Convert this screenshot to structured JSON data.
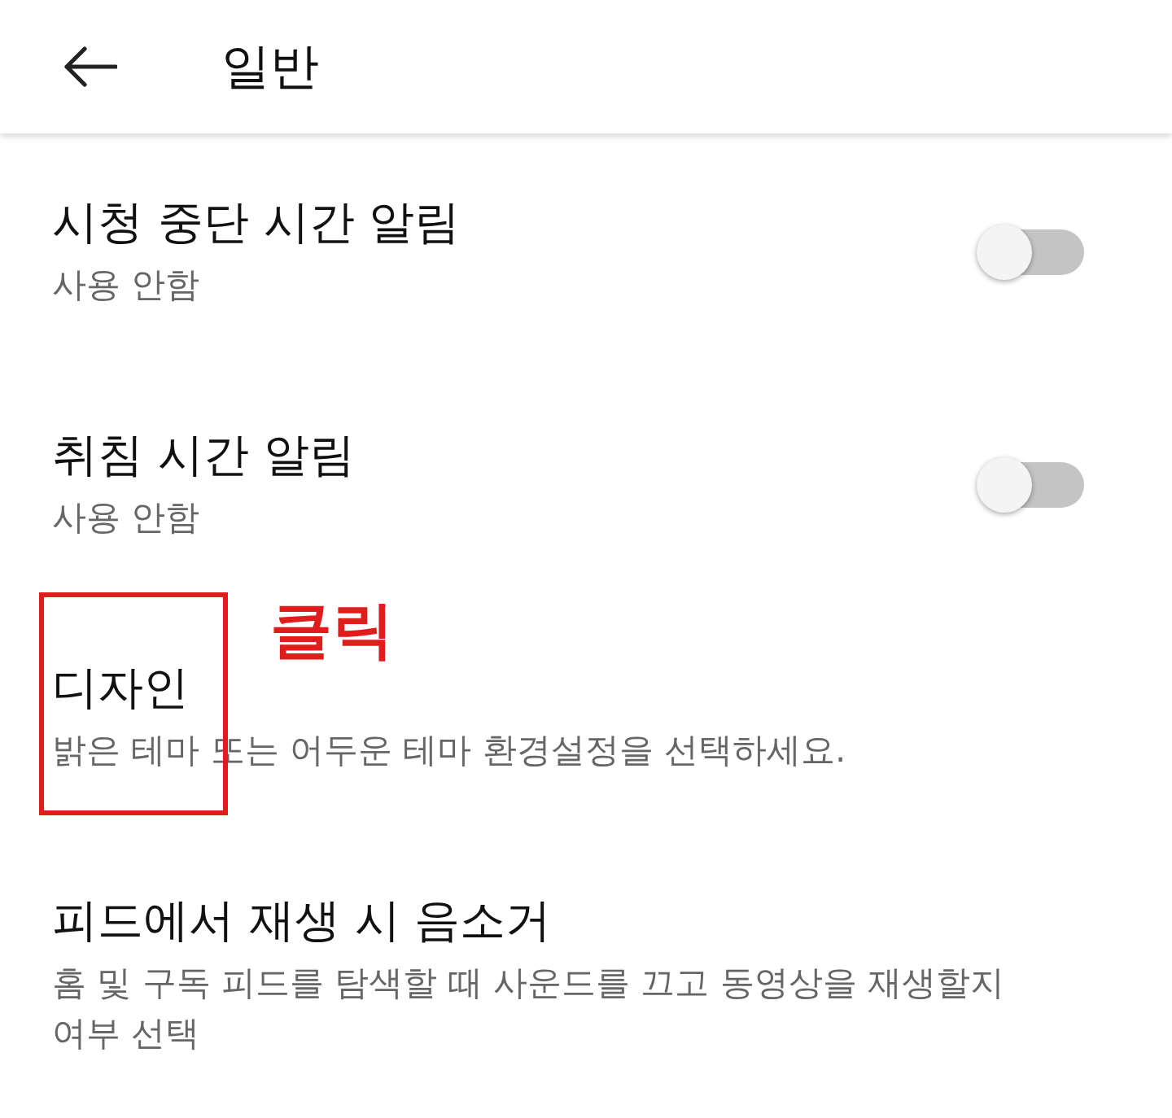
{
  "header": {
    "title": "일반"
  },
  "settings": [
    {
      "kind": "toggle",
      "title": "시청 중단 시간 알림",
      "subtitle": "사용 안함",
      "on": false
    },
    {
      "kind": "toggle",
      "title": "취침 시간 알림",
      "subtitle": "사용 안함",
      "on": false
    },
    {
      "kind": "text",
      "title": "디자인",
      "subtitle": "밝은 테마 또는 어두운 테마 환경설정을 선택하세요.",
      "annotation": "클릭"
    },
    {
      "kind": "text",
      "title": "피드에서 재생 시 음소거",
      "subtitle": "홈 및 구독 피드를 탐색할 때 사운드를 끄고 동영상을 재생할지 여부 선택"
    }
  ]
}
